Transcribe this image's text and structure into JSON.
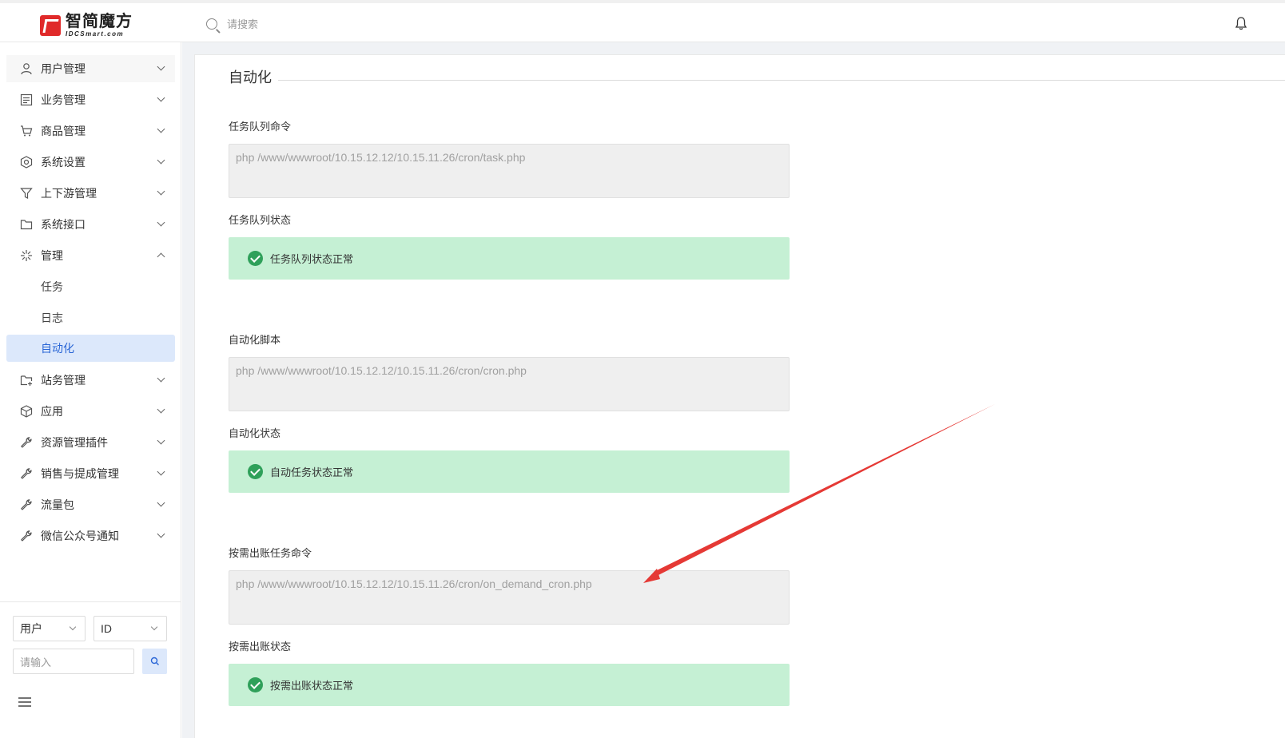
{
  "header": {
    "logo_cn": "智简魔方",
    "logo_en": "IDCSmart.com",
    "search_placeholder": "请搜索"
  },
  "sidebar": {
    "menu": [
      {
        "label": "用户管理",
        "icon": "user-icon"
      },
      {
        "label": "业务管理",
        "icon": "list-icon"
      },
      {
        "label": "商品管理",
        "icon": "cart-icon"
      },
      {
        "label": "系统设置",
        "icon": "settings-icon"
      },
      {
        "label": "上下游管理",
        "icon": "filter-icon"
      },
      {
        "label": "系统接口",
        "icon": "folder-icon"
      },
      {
        "label": "管理",
        "icon": "sparkle-icon"
      }
    ],
    "submenu": [
      {
        "label": "任务"
      },
      {
        "label": "日志"
      },
      {
        "label": "自动化"
      }
    ],
    "menu_after": [
      {
        "label": "站务管理",
        "icon": "folder-plus-icon"
      },
      {
        "label": "应用",
        "icon": "box-icon"
      },
      {
        "label": "资源管理插件",
        "icon": "wrench-icon"
      },
      {
        "label": "销售与提成管理",
        "icon": "wrench-icon"
      },
      {
        "label": "流量包",
        "icon": "wrench-icon"
      },
      {
        "label": "微信公众号通知",
        "icon": "wrench-icon"
      }
    ],
    "filter": {
      "type_select": "用户",
      "field_select": "ID",
      "input_placeholder": "请输入"
    }
  },
  "main": {
    "title": "自动化",
    "sections": [
      {
        "label": "任务队列命令",
        "command": "php /www/wwwroot/10.15.12.12/10.15.11.26/cron/task.php"
      },
      {
        "label": "任务队列状态",
        "status": "任务队列状态正常"
      },
      {
        "label": "自动化脚本",
        "command": "php /www/wwwroot/10.15.12.12/10.15.11.26/cron/cron.php"
      },
      {
        "label": "自动化状态",
        "status": "自动任务状态正常"
      },
      {
        "label": "按需出账任务命令",
        "command": "php /www/wwwroot/10.15.12.12/10.15.11.26/cron/on_demand_cron.php"
      },
      {
        "label": "按需出账状态",
        "status": "按需出账状态正常"
      }
    ]
  },
  "colors": {
    "accent": "#2a66d6",
    "active_bg": "#dce8fb",
    "success_bg": "#c5f0d4",
    "success_icon": "#2fa05a",
    "annotation_arrow": "#e53935"
  }
}
